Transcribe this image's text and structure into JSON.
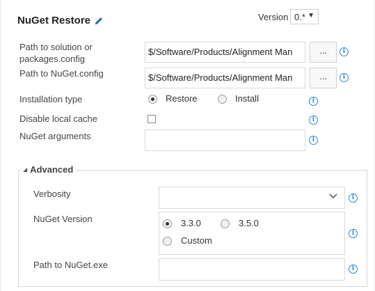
{
  "header": {
    "title": "NuGet Restore",
    "edit_icon": "pencil-icon",
    "version_label": "Version",
    "version_value": "0.*"
  },
  "fields": {
    "solution_path": {
      "label_line1": "Path to solution or",
      "label_line2": "packages.config",
      "value": "$/Software/Products/Alignment Man",
      "browse_label": "..."
    },
    "nuget_config": {
      "label": "Path to NuGet.config",
      "value": "$/Software/Products/Alignment Man",
      "browse_label": "..."
    },
    "installation_type": {
      "label": "Installation type",
      "options": [
        "Restore",
        "Install"
      ],
      "selected": "Restore"
    },
    "disable_cache": {
      "label": "Disable local cache",
      "checked": false
    },
    "nuget_arguments": {
      "label": "NuGet arguments",
      "value": ""
    }
  },
  "advanced": {
    "legend": "Advanced",
    "verbosity": {
      "label": "Verbosity",
      "value": ""
    },
    "nuget_version": {
      "label": "NuGet Version",
      "options": [
        "3.3.0",
        "3.5.0",
        "Custom"
      ],
      "selected": "3.3.0"
    },
    "nuget_exe": {
      "label": "Path to NuGet.exe",
      "value": ""
    }
  },
  "icons": {
    "info": "info-icon",
    "browse": "ellipsis",
    "dropdown": "chevron-down-icon"
  },
  "colors": {
    "accent": "#2b88d8",
    "border": "#d9d9d9"
  }
}
